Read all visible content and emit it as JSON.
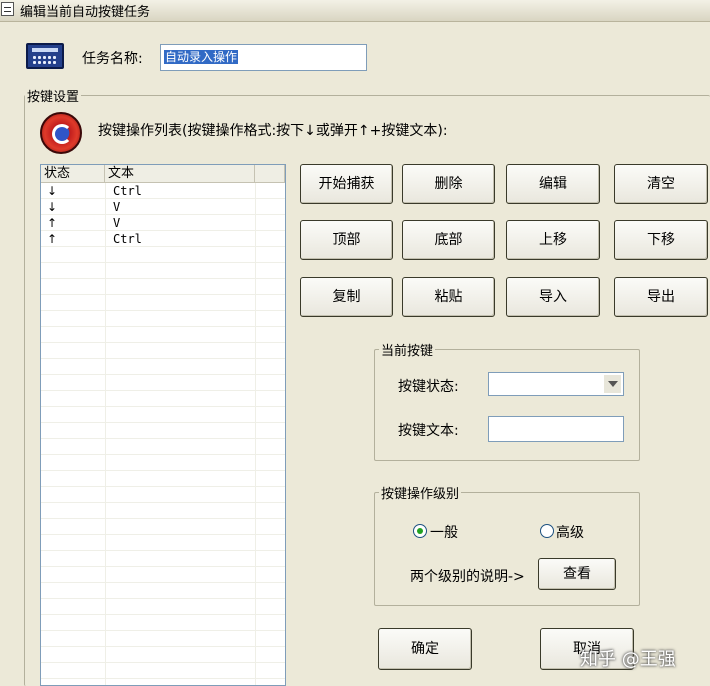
{
  "window": {
    "title": "编辑当前自动按键任务"
  },
  "task": {
    "name_label": "任务名称:",
    "name_value": "自动录入操作"
  },
  "group_keys": {
    "legend": "按键设置"
  },
  "list": {
    "description": "按键操作列表(按键操作格式:按下↓或弹开↑+按键文本):",
    "columns": [
      "状态",
      "文本"
    ],
    "rows": [
      {
        "state": "↓",
        "text": "Ctrl"
      },
      {
        "state": "↓",
        "text": "V"
      },
      {
        "state": "↑",
        "text": "V"
      },
      {
        "state": "↑",
        "text": "Ctrl"
      }
    ]
  },
  "buttons": {
    "start_capture": "开始捕获",
    "delete": "删除",
    "edit": "编辑",
    "clear": "清空",
    "top": "顶部",
    "bottom": "底部",
    "move_up": "上移",
    "move_down": "下移",
    "copy": "复制",
    "paste": "粘贴",
    "import": "导入",
    "export": "导出",
    "ok": "确定",
    "cancel": "取消",
    "view": "查看"
  },
  "current_key": {
    "legend": "当前按键",
    "state_label": "按键状态:",
    "state_value": "",
    "text_label": "按键文本:",
    "text_value": ""
  },
  "level": {
    "legend": "按键操作级别",
    "normal": "一般",
    "high": "高级",
    "selected": "一般",
    "explain": "两个级别的说明->"
  },
  "watermark": "知乎 @王强",
  "colors": {
    "selection": "#316ac5",
    "radio_dot": "#21a121",
    "window_bg": "#ece9d8"
  }
}
